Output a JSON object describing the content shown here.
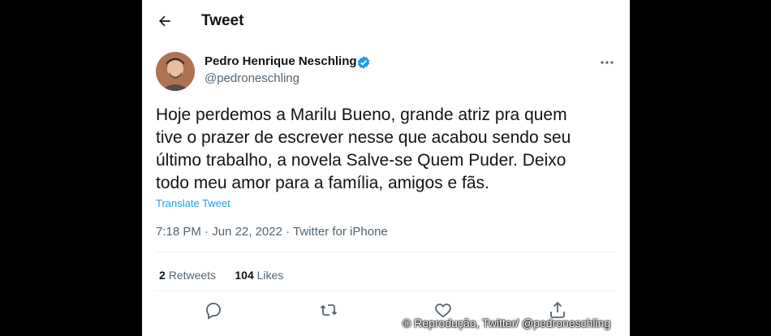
{
  "header": {
    "title": "Tweet",
    "back_icon": "arrow-left-icon"
  },
  "author": {
    "name": "Pedro Henrique Neschling",
    "handle": "@pedroneschling",
    "verified_icon": "verified-badge-icon",
    "verified_color": "#1d9bf0"
  },
  "tweet": {
    "text_lines": [
      "Hoje perdemos a Marilu Bueno, grande atriz pra quem",
      "tive o prazer de escrever nesse que acabou sendo seu",
      "último trabalho, a novela Salve-se Quem Puder. Deixo",
      "todo meu amor para a família, amigos e fãs."
    ],
    "translate_label": "Translate Tweet",
    "time": "7:18 PM",
    "date": "Jun 22, 2022",
    "source": "Twitter for iPhone",
    "separator": "·"
  },
  "stats": {
    "retweets_count": "2",
    "retweets_label": "Retweets",
    "likes_count": "104",
    "likes_label": "Likes"
  },
  "actions": [
    "reply-icon",
    "retweet-icon",
    "like-icon",
    "share-icon"
  ],
  "watermark": "© Reprodução, Twitter/ @pedroneschling",
  "colors": {
    "accent": "#1d9bf0",
    "text": "#0f1419",
    "muted": "#536471",
    "background": "#000000"
  }
}
